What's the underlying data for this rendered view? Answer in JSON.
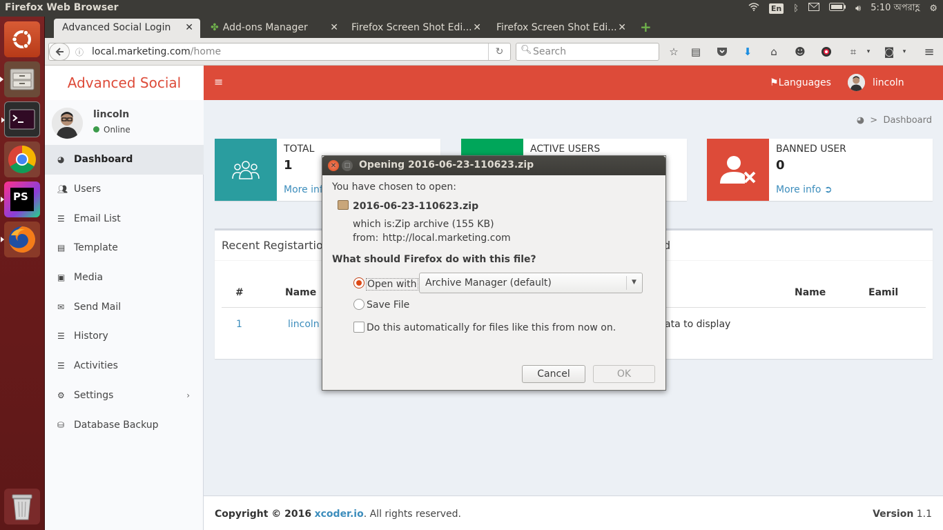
{
  "os": {
    "window_title": "Firefox Web Browser",
    "keyboard_layout": "En",
    "clock": "5:10 অপরাহ্ণ"
  },
  "launcher": {
    "items": [
      "ubuntu-dash",
      "files",
      "terminal",
      "chrome",
      "phpstorm",
      "firefox",
      "trash"
    ],
    "phpstorm_label": "PS"
  },
  "browser": {
    "tabs": [
      {
        "label": "Advanced Social Login",
        "active": true
      },
      {
        "label": "Add-ons Manager",
        "active": false
      },
      {
        "label": "Firefox Screen Shot Edi...",
        "active": false
      },
      {
        "label": "Firefox Screen Shot Edi...",
        "active": false
      }
    ],
    "url_host": "local.marketing.com",
    "url_path": "/home",
    "search_placeholder": "Search"
  },
  "app": {
    "logo": "Advanced Social",
    "user": {
      "name": "lincoln",
      "status": "Online"
    },
    "menu": [
      {
        "label": "Dashboard",
        "icon": "dashboard-icon",
        "active": true
      },
      {
        "label": "Users",
        "icon": "users-icon"
      },
      {
        "label": "Email List",
        "icon": "list-icon"
      },
      {
        "label": "Template",
        "icon": "template-icon"
      },
      {
        "label": "Media",
        "icon": "image-icon"
      },
      {
        "label": "Send Mail",
        "icon": "envelope-icon"
      },
      {
        "label": "History",
        "icon": "list-icon"
      },
      {
        "label": "Activities",
        "icon": "list-icon"
      },
      {
        "label": "Settings",
        "icon": "gears-icon",
        "has_submenu": true
      },
      {
        "label": "Database Backup",
        "icon": "database-icon"
      }
    ],
    "header": {
      "languages": "Languages",
      "user": "lincoln"
    },
    "breadcrumb": "Dashboard",
    "stats": [
      {
        "label": "TOTAL",
        "value": "1",
        "more": "More info",
        "color": "#2a9d9f"
      },
      {
        "label": "ACTIVE USERS",
        "value": "",
        "more": "",
        "color": "#00a65a"
      },
      {
        "label": "BANNED USER",
        "value": "0",
        "more": "More info",
        "color": "#dd4b39"
      }
    ],
    "recent": {
      "title": "Recent Registartion",
      "title_tail": "d",
      "columns_left": [
        "#",
        "Name"
      ],
      "columns_right": [
        "Name",
        "Eamil"
      ],
      "rows": [
        {
          "num": "1",
          "name": "lincoln"
        }
      ],
      "empty_tail": "ata to display"
    },
    "footer": {
      "copyright_prefix": "Copyright © 2016",
      "company": "xcoder.io",
      "copyright_suffix": ". All rights reserved.",
      "version_label": "Version",
      "version": "1.1"
    }
  },
  "dialog": {
    "title": "Opening 2016-06-23-110623.zip",
    "chosen_text": "You have chosen to open:",
    "filename": "2016-06-23-110623.zip",
    "which_is_label": "which is:",
    "which_is_value": "Zip archive (155 KB)",
    "from_label": "from:",
    "from_value": "http://local.marketing.com",
    "question": "What should Firefox do with this file?",
    "open_with_label": "Open with",
    "open_with_app": "Archive Manager (default)",
    "save_file_label": "Save File",
    "auto_label": "Do this automatically for files like this from now on.",
    "selected_action": "open_with",
    "auto_checked": false,
    "cancel": "Cancel",
    "ok": "OK"
  }
}
